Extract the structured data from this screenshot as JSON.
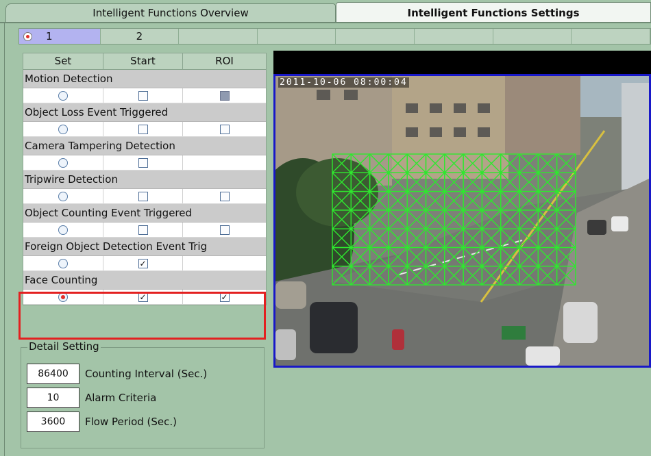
{
  "tabs": [
    {
      "label": "Intelligent Functions Overview"
    },
    {
      "label": "Intelligent Functions Settings"
    }
  ],
  "channels": [
    {
      "label": "1",
      "selected": true
    },
    {
      "label": "2",
      "selected": false
    }
  ],
  "table": {
    "headers": [
      "Set",
      "Start",
      "ROI"
    ],
    "rows": [
      {
        "name": "Motion Detection",
        "set": false,
        "start": false,
        "roi": "disabled"
      },
      {
        "name": "Object Loss Event Triggered",
        "set": false,
        "start": false,
        "roi": "unchecked"
      },
      {
        "name": "Camera Tampering Detection",
        "set": false,
        "start": false,
        "roi": "none"
      },
      {
        "name": "Tripwire Detection",
        "set": false,
        "start": false,
        "roi": "unchecked"
      },
      {
        "name": "Object Counting Event Triggered",
        "set": false,
        "start": false,
        "roi": "unchecked"
      },
      {
        "name": "Foreign Object Detection Event Trig",
        "set": false,
        "start": true,
        "roi": "none"
      },
      {
        "name": "Face Counting",
        "set": true,
        "start": true,
        "roi": "checked"
      }
    ]
  },
  "detail": {
    "legend": "Detail Setting",
    "fields": [
      {
        "value": "86400",
        "label": "Counting Interval (Sec.)"
      },
      {
        "value": "10",
        "label": "Alarm Criteria"
      },
      {
        "value": "3600",
        "label": "Flow Period (Sec.)"
      }
    ]
  },
  "camera": {
    "timestamp": "2011-10-06  08:00:04"
  },
  "colors": {
    "background": "#a3c4a8",
    "selected_channel": "#b3b3f0",
    "highlight": "#e32020",
    "camera_border": "#1818c8",
    "roi_grid": "#2ee82e"
  }
}
